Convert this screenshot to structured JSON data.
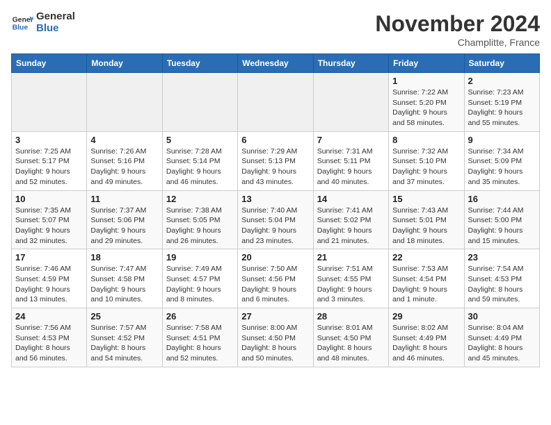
{
  "header": {
    "logo_line1": "General",
    "logo_line2": "Blue",
    "month_title": "November 2024",
    "location": "Champlitte, France"
  },
  "days_of_week": [
    "Sunday",
    "Monday",
    "Tuesday",
    "Wednesday",
    "Thursday",
    "Friday",
    "Saturday"
  ],
  "weeks": [
    [
      {
        "day": "",
        "info": ""
      },
      {
        "day": "",
        "info": ""
      },
      {
        "day": "",
        "info": ""
      },
      {
        "day": "",
        "info": ""
      },
      {
        "day": "",
        "info": ""
      },
      {
        "day": "1",
        "info": "Sunrise: 7:22 AM\nSunset: 5:20 PM\nDaylight: 9 hours and 58 minutes."
      },
      {
        "day": "2",
        "info": "Sunrise: 7:23 AM\nSunset: 5:19 PM\nDaylight: 9 hours and 55 minutes."
      }
    ],
    [
      {
        "day": "3",
        "info": "Sunrise: 7:25 AM\nSunset: 5:17 PM\nDaylight: 9 hours and 52 minutes."
      },
      {
        "day": "4",
        "info": "Sunrise: 7:26 AM\nSunset: 5:16 PM\nDaylight: 9 hours and 49 minutes."
      },
      {
        "day": "5",
        "info": "Sunrise: 7:28 AM\nSunset: 5:14 PM\nDaylight: 9 hours and 46 minutes."
      },
      {
        "day": "6",
        "info": "Sunrise: 7:29 AM\nSunset: 5:13 PM\nDaylight: 9 hours and 43 minutes."
      },
      {
        "day": "7",
        "info": "Sunrise: 7:31 AM\nSunset: 5:11 PM\nDaylight: 9 hours and 40 minutes."
      },
      {
        "day": "8",
        "info": "Sunrise: 7:32 AM\nSunset: 5:10 PM\nDaylight: 9 hours and 37 minutes."
      },
      {
        "day": "9",
        "info": "Sunrise: 7:34 AM\nSunset: 5:09 PM\nDaylight: 9 hours and 35 minutes."
      }
    ],
    [
      {
        "day": "10",
        "info": "Sunrise: 7:35 AM\nSunset: 5:07 PM\nDaylight: 9 hours and 32 minutes."
      },
      {
        "day": "11",
        "info": "Sunrise: 7:37 AM\nSunset: 5:06 PM\nDaylight: 9 hours and 29 minutes."
      },
      {
        "day": "12",
        "info": "Sunrise: 7:38 AM\nSunset: 5:05 PM\nDaylight: 9 hours and 26 minutes."
      },
      {
        "day": "13",
        "info": "Sunrise: 7:40 AM\nSunset: 5:04 PM\nDaylight: 9 hours and 23 minutes."
      },
      {
        "day": "14",
        "info": "Sunrise: 7:41 AM\nSunset: 5:02 PM\nDaylight: 9 hours and 21 minutes."
      },
      {
        "day": "15",
        "info": "Sunrise: 7:43 AM\nSunset: 5:01 PM\nDaylight: 9 hours and 18 minutes."
      },
      {
        "day": "16",
        "info": "Sunrise: 7:44 AM\nSunset: 5:00 PM\nDaylight: 9 hours and 15 minutes."
      }
    ],
    [
      {
        "day": "17",
        "info": "Sunrise: 7:46 AM\nSunset: 4:59 PM\nDaylight: 9 hours and 13 minutes."
      },
      {
        "day": "18",
        "info": "Sunrise: 7:47 AM\nSunset: 4:58 PM\nDaylight: 9 hours and 10 minutes."
      },
      {
        "day": "19",
        "info": "Sunrise: 7:49 AM\nSunset: 4:57 PM\nDaylight: 9 hours and 8 minutes."
      },
      {
        "day": "20",
        "info": "Sunrise: 7:50 AM\nSunset: 4:56 PM\nDaylight: 9 hours and 6 minutes."
      },
      {
        "day": "21",
        "info": "Sunrise: 7:51 AM\nSunset: 4:55 PM\nDaylight: 9 hours and 3 minutes."
      },
      {
        "day": "22",
        "info": "Sunrise: 7:53 AM\nSunset: 4:54 PM\nDaylight: 9 hours and 1 minute."
      },
      {
        "day": "23",
        "info": "Sunrise: 7:54 AM\nSunset: 4:53 PM\nDaylight: 8 hours and 59 minutes."
      }
    ],
    [
      {
        "day": "24",
        "info": "Sunrise: 7:56 AM\nSunset: 4:53 PM\nDaylight: 8 hours and 56 minutes."
      },
      {
        "day": "25",
        "info": "Sunrise: 7:57 AM\nSunset: 4:52 PM\nDaylight: 8 hours and 54 minutes."
      },
      {
        "day": "26",
        "info": "Sunrise: 7:58 AM\nSunset: 4:51 PM\nDaylight: 8 hours and 52 minutes."
      },
      {
        "day": "27",
        "info": "Sunrise: 8:00 AM\nSunset: 4:50 PM\nDaylight: 8 hours and 50 minutes."
      },
      {
        "day": "28",
        "info": "Sunrise: 8:01 AM\nSunset: 4:50 PM\nDaylight: 8 hours and 48 minutes."
      },
      {
        "day": "29",
        "info": "Sunrise: 8:02 AM\nSunset: 4:49 PM\nDaylight: 8 hours and 46 minutes."
      },
      {
        "day": "30",
        "info": "Sunrise: 8:04 AM\nSunset: 4:49 PM\nDaylight: 8 hours and 45 minutes."
      }
    ]
  ]
}
